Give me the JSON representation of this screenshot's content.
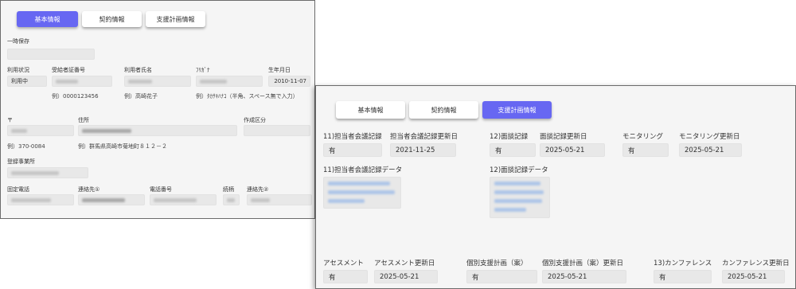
{
  "tabs": [
    {
      "label": "基本情報"
    },
    {
      "label": "契約情報"
    },
    {
      "label": "支援計画情報"
    }
  ],
  "basic": {
    "temp_save_label": "一時保存",
    "status_label": "利用状況",
    "status_value": "利用中",
    "cert_no_label": "受給者証番号",
    "cert_no_example": "例）0000123456",
    "user_name_label": "利用者氏名",
    "user_name_example": "例）高崎花子",
    "kana_label": "ﾌﾘｶﾞﾅ",
    "kana_example": "例）ﾀｶｻｷﾊﾅｺ（半角、スペース無で入力）",
    "birth_label": "生年月日",
    "birth_value": "2010-11-07",
    "postal_label": "〒",
    "postal_example": "例）370-0084",
    "address_label": "住所",
    "address_example": "例）群馬県高崎市菊地町８１２－２",
    "created_section_label": "作成区分",
    "office_label": "登録事業所",
    "landline_label": "固定電話",
    "contact1_label": "連絡先①",
    "phone_label": "電話番号",
    "relation_label": "続柄",
    "contact2_label": "連絡先②"
  },
  "plan": {
    "meeting11_label": "11)担当者会議記録",
    "meeting11_value": "有",
    "meeting11_date_label": "担当者会議記録更新日",
    "meeting11_date_value": "2021-11-25",
    "interview12_label": "12)面談記録",
    "interview12_value": "有",
    "interview12_date_label": "面談記録更新日",
    "interview12_date_value": "2025-05-21",
    "monitoring_label": "モニタリング",
    "monitoring_value": "有",
    "monitoring_date_label": "モニタリング更新日",
    "monitoring_date_value": "2025-05-21",
    "meeting11_data_label": "11)担当者会議記録データ",
    "interview12_data_label": "12)面談記録データ",
    "assessment_label": "アセスメント",
    "assessment_value": "有",
    "assessment_date_label": "アセスメント更新日",
    "assessment_date_value": "2025-05-21",
    "individual_plan_label": "個別支援計画（案）",
    "individual_plan_value": "有",
    "individual_plan_date_label": "個別支援計画（案）更新日",
    "individual_plan_date_value": "2025-05-21",
    "conference13_label": "13)カンファレンス",
    "conference13_value": "有",
    "conference13_date_label": "カンファレンス更新日",
    "conference13_date_value": "2025-05-21"
  }
}
